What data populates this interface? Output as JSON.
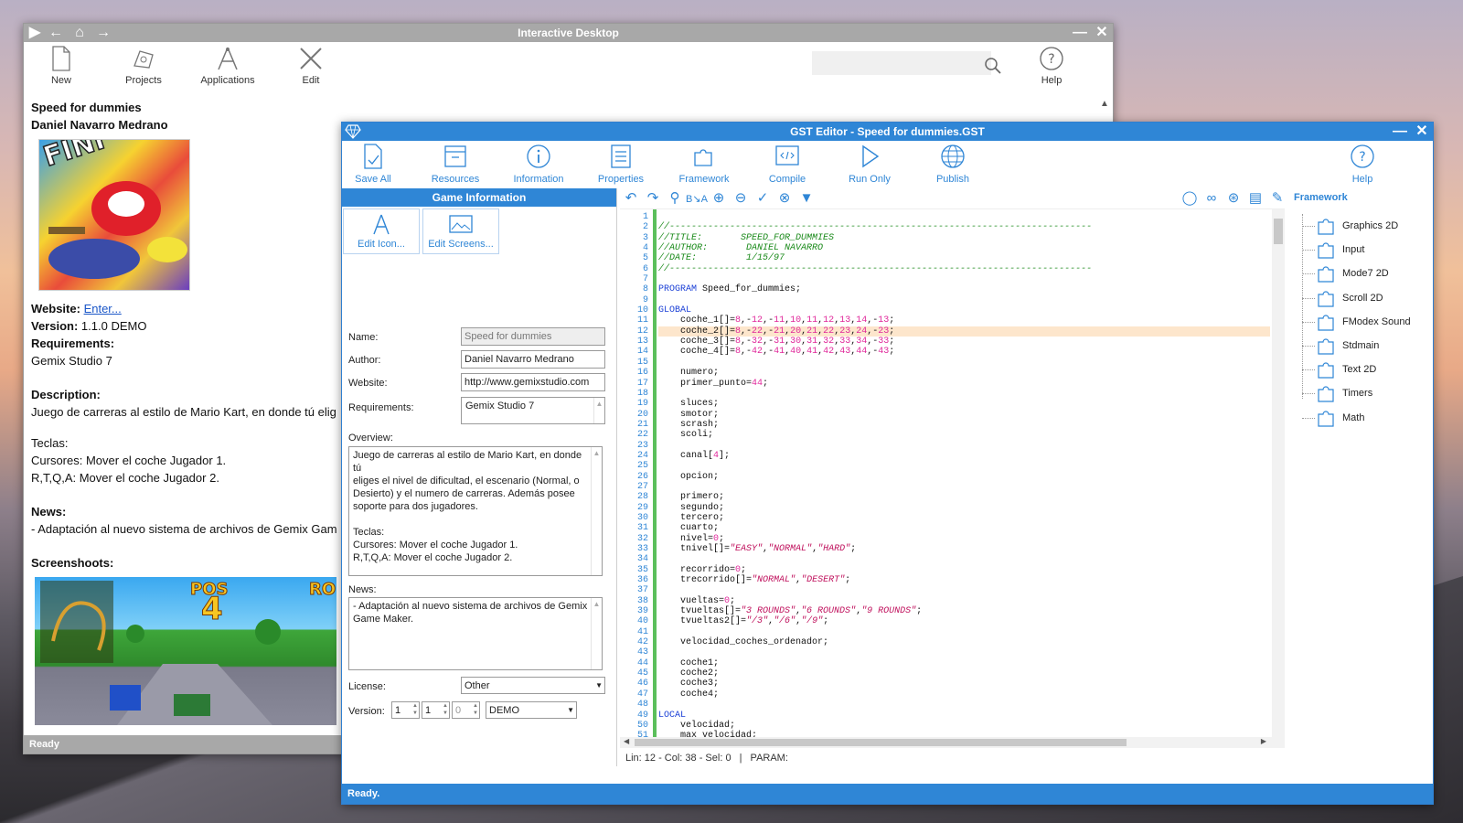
{
  "desktop": {
    "title": "Interactive Desktop",
    "ribbon": [
      {
        "label": "New",
        "icon": "new-file-icon"
      },
      {
        "label": "Projects",
        "icon": "projects-icon"
      },
      {
        "label": "Applications",
        "icon": "applications-icon"
      },
      {
        "label": "Edit",
        "icon": "edit-tools-icon"
      }
    ],
    "help_label": "Help",
    "game_title": "Speed for dummies",
    "game_author": "Daniel Navarro Medrano",
    "website_label": "Website:",
    "website_link": "Enter...",
    "version_label": "Version:",
    "version_value": "1.1.0 DEMO",
    "requirements_label": "Requirements:",
    "requirements_value": "Gemix Studio 7",
    "description_label": "Description:",
    "description_value": "Juego de carreras al estilo de Mario Kart, en donde tú elig",
    "teclas_label": "Teclas:",
    "teclas_line1": "Cursores: Mover el coche Jugador 1.",
    "teclas_line2": "R,T,Q,A: Mover el coche Jugador 2.",
    "news_label": "News:",
    "news_value": "- Adaptación al nuevo sistema de archivos de Gemix Gam",
    "screens_label": "Screenshoots:",
    "cover_text": "FINI",
    "shot_text1": "POS",
    "shot_text2": "4",
    "shot_text3": "RO",
    "status": "Ready"
  },
  "editor": {
    "title": "GST Editor - Speed for dummies.GST",
    "ribbon": [
      {
        "label": "Save All",
        "icon": "save-all-icon"
      },
      {
        "label": "Resources",
        "icon": "resources-icon"
      },
      {
        "label": "Information",
        "icon": "information-icon"
      },
      {
        "label": "Properties",
        "icon": "properties-icon"
      },
      {
        "label": "Framework",
        "icon": "framework-icon"
      },
      {
        "label": "Compile",
        "icon": "compile-icon"
      },
      {
        "label": "Run Only",
        "icon": "run-icon"
      },
      {
        "label": "Publish",
        "icon": "publish-icon"
      }
    ],
    "help_label": "Help",
    "panel_title": "Game Information",
    "edit_icon_label": "Edit Icon...",
    "edit_screens_label": "Edit Screens...",
    "name_label": "Name:",
    "name_value": "Speed for dummies",
    "author_label": "Author:",
    "author_value": "Daniel Navarro Medrano",
    "website_label": "Website:",
    "website_value": "http://www.gemixstudio.com",
    "requirements_label": "Requirements:",
    "requirements_value": "Gemix Studio 7",
    "overview_label": "Overview:",
    "overview_lines": [
      "Juego de carreras al estilo de Mario Kart, en donde tú",
      "eliges el nivel de dificultad, el escenario (Normal, o",
      "Desierto) y el numero de carreras. Además posee",
      "soporte para dos jugadores.",
      "",
      "Teclas:",
      "Cursores: Mover el coche Jugador 1.",
      "R,T,Q,A: Mover el coche Jugador 2."
    ],
    "news_label": "News:",
    "news_lines": [
      "- Adaptación al nuevo sistema de archivos de Gemix",
      "Game Maker."
    ],
    "license_label": "License:",
    "license_value": "Other",
    "version_label": "Version:",
    "version_major": "1",
    "version_minor": "1",
    "version_patch": "0",
    "version_stage": "DEMO",
    "framework_label": "Framework",
    "framework_items": [
      "Graphics 2D",
      "Input",
      "Mode7 2D",
      "Scroll 2D",
      "FModex Sound",
      "Stdmain",
      "Text 2D",
      "Timers",
      "Math"
    ],
    "cursor_status": "Lin: 12 - Col: 38 - Sel: 0",
    "param_status": "PARAM:",
    "status": "Ready.",
    "highlight_line": 12,
    "code_lines": [
      [],
      [
        {
          "t": "//-----------------------------------------------------------------------------",
          "c": "cm"
        }
      ],
      [
        {
          "t": "//TITLE:       SPEED_FOR_DUMMIES",
          "c": "cm"
        }
      ],
      [
        {
          "t": "//AUTHOR:       DANIEL NAVARRO",
          "c": "cm"
        }
      ],
      [
        {
          "t": "//DATE:         1/15/97",
          "c": "cm"
        }
      ],
      [
        {
          "t": "//-----------------------------------------------------------------------------",
          "c": "cm"
        }
      ],
      [],
      [
        {
          "t": "PROGRAM",
          "c": "kw"
        },
        {
          "t": " Speed_for_dummies;"
        }
      ],
      [],
      [
        {
          "t": "GLOBAL",
          "c": "kw"
        }
      ],
      [
        {
          "t": "    coche_1[]="
        },
        {
          "t": "8",
          "c": "num"
        },
        {
          "t": ",-"
        },
        {
          "t": "12",
          "c": "num"
        },
        {
          "t": ",-"
        },
        {
          "t": "11",
          "c": "num"
        },
        {
          "t": ","
        },
        {
          "t": "10",
          "c": "num"
        },
        {
          "t": ","
        },
        {
          "t": "11",
          "c": "num"
        },
        {
          "t": ","
        },
        {
          "t": "12",
          "c": "num"
        },
        {
          "t": ","
        },
        {
          "t": "13",
          "c": "num"
        },
        {
          "t": ","
        },
        {
          "t": "14",
          "c": "num"
        },
        {
          "t": ",-"
        },
        {
          "t": "13",
          "c": "num"
        },
        {
          "t": ";"
        }
      ],
      [
        {
          "t": "    coche_2[]="
        },
        {
          "t": "8",
          "c": "num"
        },
        {
          "t": ",-"
        },
        {
          "t": "22",
          "c": "num"
        },
        {
          "t": ",-"
        },
        {
          "t": "21",
          "c": "num"
        },
        {
          "t": ","
        },
        {
          "t": "20",
          "c": "num"
        },
        {
          "t": ","
        },
        {
          "t": "21",
          "c": "num"
        },
        {
          "t": ","
        },
        {
          "t": "22",
          "c": "num"
        },
        {
          "t": ","
        },
        {
          "t": "23",
          "c": "num"
        },
        {
          "t": ","
        },
        {
          "t": "24",
          "c": "num"
        },
        {
          "t": ",-"
        },
        {
          "t": "23",
          "c": "num"
        },
        {
          "t": ";"
        }
      ],
      [
        {
          "t": "    coche_3[]="
        },
        {
          "t": "8",
          "c": "num"
        },
        {
          "t": ",-"
        },
        {
          "t": "32",
          "c": "num"
        },
        {
          "t": ",-"
        },
        {
          "t": "31",
          "c": "num"
        },
        {
          "t": ","
        },
        {
          "t": "30",
          "c": "num"
        },
        {
          "t": ","
        },
        {
          "t": "31",
          "c": "num"
        },
        {
          "t": ","
        },
        {
          "t": "32",
          "c": "num"
        },
        {
          "t": ","
        },
        {
          "t": "33",
          "c": "num"
        },
        {
          "t": ","
        },
        {
          "t": "34",
          "c": "num"
        },
        {
          "t": ",-"
        },
        {
          "t": "33",
          "c": "num"
        },
        {
          "t": ";"
        }
      ],
      [
        {
          "t": "    coche_4[]="
        },
        {
          "t": "8",
          "c": "num"
        },
        {
          "t": ",-"
        },
        {
          "t": "42",
          "c": "num"
        },
        {
          "t": ",-"
        },
        {
          "t": "41",
          "c": "num"
        },
        {
          "t": ","
        },
        {
          "t": "40",
          "c": "num"
        },
        {
          "t": ","
        },
        {
          "t": "41",
          "c": "num"
        },
        {
          "t": ","
        },
        {
          "t": "42",
          "c": "num"
        },
        {
          "t": ","
        },
        {
          "t": "43",
          "c": "num"
        },
        {
          "t": ","
        },
        {
          "t": "44",
          "c": "num"
        },
        {
          "t": ",-"
        },
        {
          "t": "43",
          "c": "num"
        },
        {
          "t": ";"
        }
      ],
      [],
      [
        {
          "t": "    numero;"
        }
      ],
      [
        {
          "t": "    primer_punto="
        },
        {
          "t": "44",
          "c": "num"
        },
        {
          "t": ";"
        }
      ],
      [],
      [
        {
          "t": "    sluces;"
        }
      ],
      [
        {
          "t": "    smotor;"
        }
      ],
      [
        {
          "t": "    scrash;"
        }
      ],
      [
        {
          "t": "    scoli;"
        }
      ],
      [],
      [
        {
          "t": "    canal["
        },
        {
          "t": "4",
          "c": "num"
        },
        {
          "t": "];"
        }
      ],
      [],
      [
        {
          "t": "    opcion;"
        }
      ],
      [],
      [
        {
          "t": "    primero;"
        }
      ],
      [
        {
          "t": "    segundo;"
        }
      ],
      [
        {
          "t": "    tercero;"
        }
      ],
      [
        {
          "t": "    cuarto;"
        }
      ],
      [
        {
          "t": "    nivel="
        },
        {
          "t": "0",
          "c": "num"
        },
        {
          "t": ";"
        }
      ],
      [
        {
          "t": "    tnivel[]="
        },
        {
          "t": "\"EASY\"",
          "c": "str"
        },
        {
          "t": ","
        },
        {
          "t": "\"NORMAL\"",
          "c": "str"
        },
        {
          "t": ","
        },
        {
          "t": "\"HARD\"",
          "c": "str"
        },
        {
          "t": ";"
        }
      ],
      [],
      [
        {
          "t": "    recorrido="
        },
        {
          "t": "0",
          "c": "num"
        },
        {
          "t": ";"
        }
      ],
      [
        {
          "t": "    trecorrido[]="
        },
        {
          "t": "\"NORMAL\"",
          "c": "str"
        },
        {
          "t": ","
        },
        {
          "t": "\"DESERT\"",
          "c": "str"
        },
        {
          "t": ";"
        }
      ],
      [],
      [
        {
          "t": "    vueltas="
        },
        {
          "t": "0",
          "c": "num"
        },
        {
          "t": ";"
        }
      ],
      [
        {
          "t": "    tvueltas[]="
        },
        {
          "t": "\"3 ROUNDS\"",
          "c": "str"
        },
        {
          "t": ","
        },
        {
          "t": "\"6 ROUNDS\"",
          "c": "str"
        },
        {
          "t": ","
        },
        {
          "t": "\"9 ROUNDS\"",
          "c": "str"
        },
        {
          "t": ";"
        }
      ],
      [
        {
          "t": "    tvueltas2[]="
        },
        {
          "t": "\"/3\"",
          "c": "str"
        },
        {
          "t": ","
        },
        {
          "t": "\"/6\"",
          "c": "str"
        },
        {
          "t": ","
        },
        {
          "t": "\"/9\"",
          "c": "str"
        },
        {
          "t": ";"
        }
      ],
      [],
      [
        {
          "t": "    velocidad_coches_ordenador;"
        }
      ],
      [],
      [
        {
          "t": "    coche1;"
        }
      ],
      [
        {
          "t": "    coche2;"
        }
      ],
      [
        {
          "t": "    coche3;"
        }
      ],
      [
        {
          "t": "    coche4;"
        }
      ],
      [],
      [
        {
          "t": "LOCAL",
          "c": "kw"
        }
      ],
      [
        {
          "t": "    velocidad;"
        }
      ],
      [
        {
          "t": "    max_velocidad;"
        }
      ]
    ]
  }
}
